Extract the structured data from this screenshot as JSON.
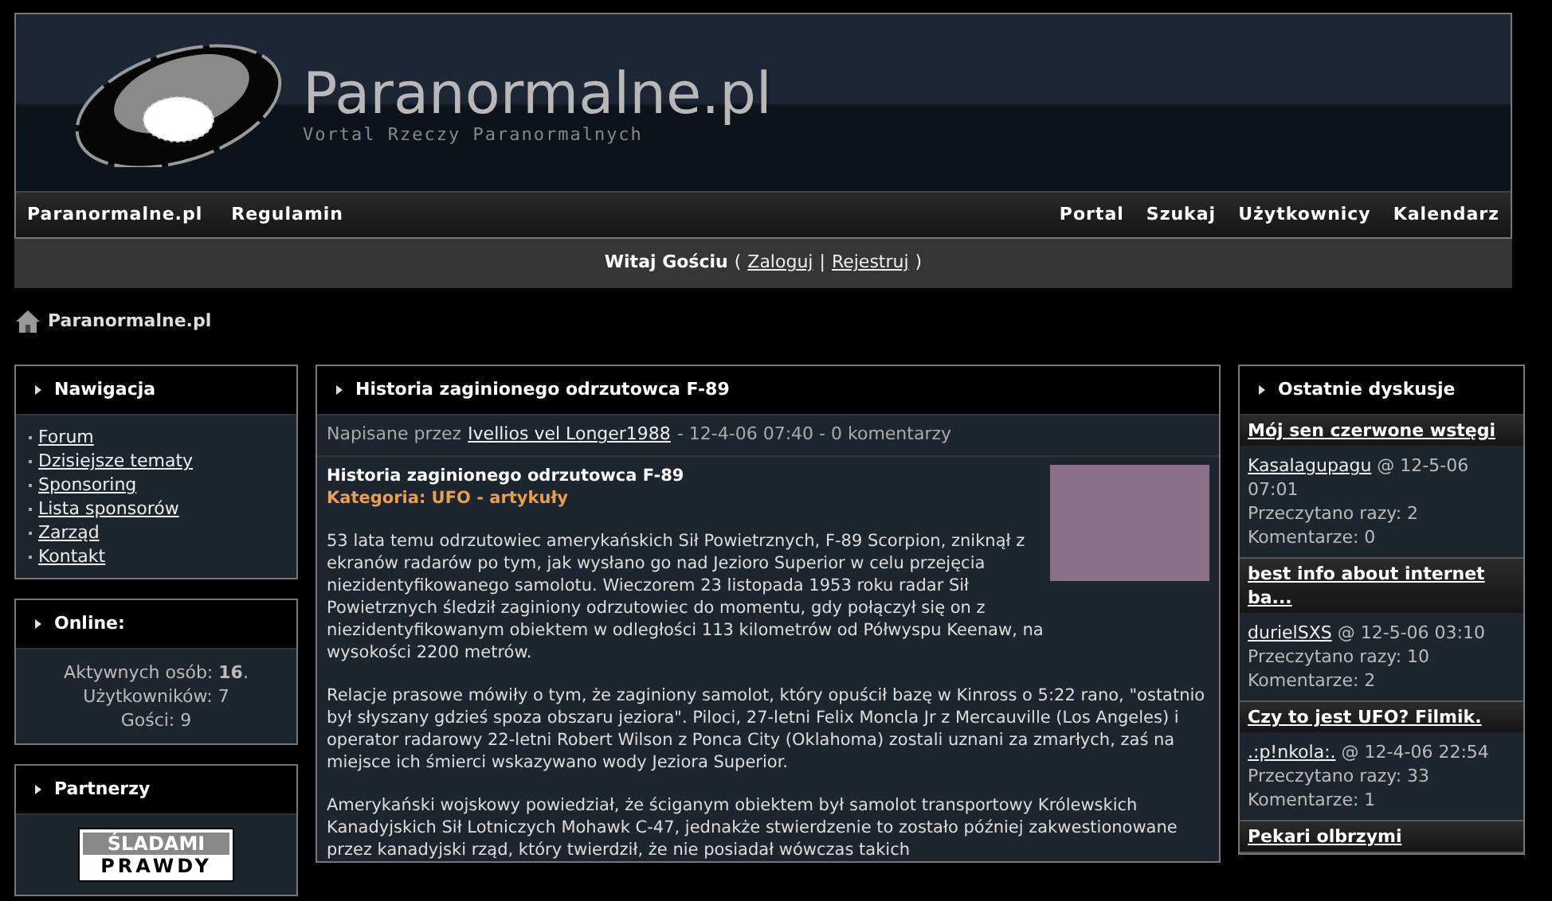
{
  "header": {
    "logo_title": "Paranormalne.pl",
    "logo_subtitle": "Vortal Rzeczy Paranormalnych"
  },
  "nav_left": [
    "Paranormalne.pl",
    "Regulamin"
  ],
  "nav_right": [
    "Portal",
    "Szukaj",
    "Użytkownicy",
    "Kalendarz"
  ],
  "welcome": {
    "greeting": "Witaj Gościu",
    "open": "(",
    "login": "Zaloguj",
    "separator": "|",
    "register": "Rejestruj",
    "close": ")"
  },
  "breadcrumb": "Paranormalne.pl",
  "navigation": {
    "title": "Nawigacja",
    "links": [
      "Forum",
      "Dzisiejsze tematy",
      "Sponsoring",
      "Lista sponsorów",
      "Zarząd",
      "Kontakt"
    ]
  },
  "online": {
    "title": "Online:",
    "lines": [
      "Aktywnych osób: **16**.",
      "Użytkowników: 7",
      "Gości: 9"
    ]
  },
  "partners": {
    "title": "Partnerzy",
    "banner_lines": [
      "ŚLADAMI",
      "PRAWDY"
    ]
  },
  "article": {
    "header_title": "Historia zaginionego odrzutowca F-89",
    "meta_prefix": "Napisane przez",
    "author": "Ivellios vel Longer1988",
    "meta_suffix": "- 12-4-06 07:40 - 0 komentarzy",
    "title": "Historia zaginionego odrzutowca F-89",
    "category": "Kategoria: UFO - artykuły",
    "paragraphs": [
      "53 lata temu odrzutowiec amerykańskich Sił Powietrznych, F-89 Scorpion, zniknął z ekranów radarów po tym, jak wysłano go nad Jezioro Superior w celu przejęcia niezidentyfikowanego samolotu. Wieczorem 23 listopada 1953 roku radar Sił Powietrznych śledził zaginiony odrzutowiec do momentu, gdy połączył się on z niezidentyfikowanym obiektem w odległości 113 kilometrów od Półwyspu Keenaw, na wysokości 2200 metrów.",
      "Relacje prasowe mówiły o tym, że zaginiony samolot, który opuścił bazę w Kinross o 5:22 rano, \"ostatnio był słyszany gdzieś spoza obszaru jeziora\". Piloci, 27-letni Felix Moncla Jr z Mercauville (Los Angeles) i operator radarowy 22-letni Robert Wilson z Ponca City (Oklahoma) zostali uznani za zmarłych, zaś na miejsce ich śmierci wskazywano wody Jeziora Superior.",
      "Amerykański wojskowy powiedział, że ściganym obiektem był samolot transportowy Królewskich Kanadyjskich Sił Lotniczych Mohawk C-47, jednakże stwierdzenie to zostało później zakwestionowane przez kanadyjski rząd, który twierdził, że nie posiadał wówczas takich"
    ]
  },
  "discussions": {
    "title": "Ostatnie dyskusje",
    "items": [
      {
        "title": "Mój sen czerwone wstęgi",
        "author": "Kasalagupagu",
        "date": "@ 12-5-06 07:01",
        "reads": "Przeczytano razy: 2",
        "comments": "Komentarze: 0"
      },
      {
        "title": "best info about internet ba...",
        "author": "durielSXS",
        "date": "@ 12-5-06 03:10",
        "reads": "Przeczytano razy: 10",
        "comments": "Komentarze: 2"
      },
      {
        "title": "Czy to jest UFO? Filmik.",
        "author": ".:p!nkola:.",
        "date": "@ 12-4-06 22:54",
        "reads": "Przeczytano razy: 33",
        "comments": "Komentarze: 1"
      },
      {
        "title": "Pekari olbrzymi"
      }
    ]
  }
}
